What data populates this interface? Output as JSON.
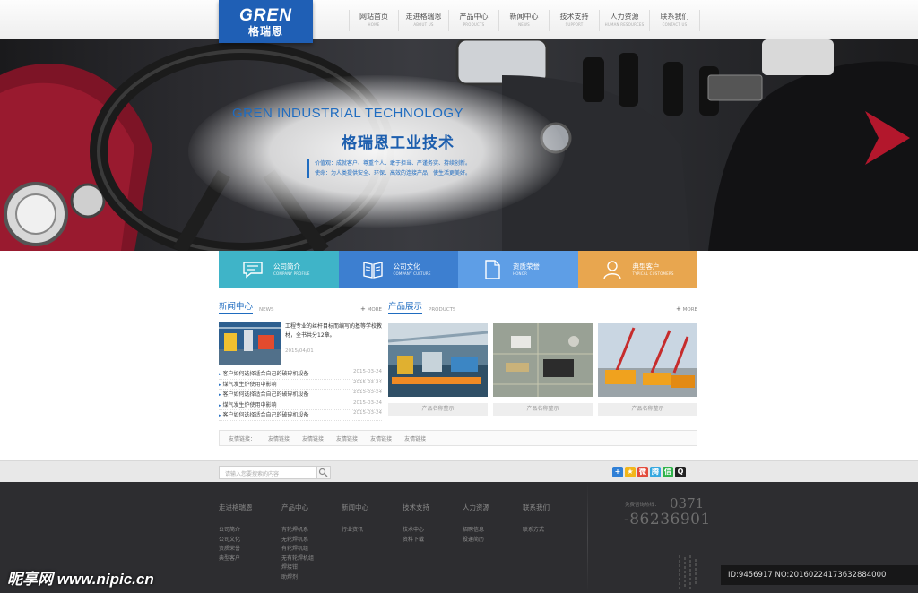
{
  "header": {
    "logo_en": "GREN",
    "logo_cn": "格瑞恩",
    "nav": [
      {
        "cn": "网站首页",
        "en": "HOME"
      },
      {
        "cn": "走进格瑞恩",
        "en": "ABOUT US"
      },
      {
        "cn": "产品中心",
        "en": "PRODUCTS"
      },
      {
        "cn": "新闻中心",
        "en": "NEWS"
      },
      {
        "cn": "技术支持",
        "en": "SUPPORT"
      },
      {
        "cn": "人力资源",
        "en": "HUMAN RESOURCES"
      },
      {
        "cn": "联系我们",
        "en": "CONTACT US"
      }
    ]
  },
  "banner": {
    "title_en": "GREN  INDUSTRIAL TECHNOLOGY",
    "title_cn": "格瑞恩工业技术",
    "line1": "价值观：成就客户、尊重个人、敢于担当、严谨务实、持续创新。",
    "line2": "使命：为人类提供安全、环保、高效的连接产品，使生活更美好。"
  },
  "tiles": [
    {
      "cn": "公司简介",
      "en": "COMPANY PROFILE",
      "color": "#3fb4c8",
      "icon": "chat-bubble-icon"
    },
    {
      "cn": "公司文化",
      "en": "COMPANY CULTURE",
      "color": "#3d7fd0",
      "icon": "open-book-icon"
    },
    {
      "cn": "资质荣誉",
      "en": "HONOR",
      "color": "#5e9ee6",
      "icon": "document-icon"
    },
    {
      "cn": "典型客户",
      "en": "TYPICAL CUSTOMERS",
      "color": "#e8a64f",
      "icon": "user-icon"
    }
  ],
  "news": {
    "title": "新闻中心",
    "title_en": "NEWS",
    "more": "MORE",
    "feature_text": "工程专业的丝杆目标而编写的基等学校教材，全书共分12章。",
    "feature_date": "2015/04/01",
    "items": [
      {
        "title": "客户如何选择适合自己的破碎机设备",
        "date": "2015-03-24"
      },
      {
        "title": "煤气发生炉使用中影响",
        "date": "2015-03-24"
      },
      {
        "title": "客户如何选择适合自己的破碎机设备",
        "date": "2015-03-24"
      },
      {
        "title": "煤气发生炉使用中影响",
        "date": "2015-03-24"
      },
      {
        "title": "客户如何选择适合自己的破碎机设备",
        "date": "2015-03-24"
      }
    ]
  },
  "products": {
    "title": "产品展示",
    "title_en": "PRODUCTS",
    "more": "MORE",
    "items": [
      {
        "caption": "产品名称整示"
      },
      {
        "caption": "产品名称整示"
      },
      {
        "caption": "产品名称整示"
      }
    ]
  },
  "links": {
    "label": "友情链接：",
    "items": [
      "友情链接",
      "友情链接",
      "友情链接",
      "友情链接",
      "友情链接"
    ]
  },
  "search": {
    "placeholder": "请输入您要搜索的内容"
  },
  "footer": {
    "columns": [
      {
        "title": "走进格瑞恩",
        "links": [
          "公司简介",
          "公司文化",
          "资质荣誉",
          "典型客户"
        ]
      },
      {
        "title": "产品中心",
        "links": [
          "有轮焊机系",
          "无轮焊机系",
          "有轮焊机组",
          "无有轮焊机组",
          "焊接钳",
          "助焊剂"
        ]
      },
      {
        "title": "新闻中心",
        "links": [
          "行业资讯"
        ]
      },
      {
        "title": "技术支持",
        "links": [
          "技术中心",
          "资料下载"
        ]
      },
      {
        "title": "人力资源",
        "links": [
          "招聘信息",
          "投递简历"
        ]
      },
      {
        "title": "联系我们",
        "links": [
          "联系方式"
        ]
      }
    ],
    "phone_label": "免费咨询热线：",
    "phone_area": "0371",
    "phone_number": "-86236901"
  },
  "watermark": {
    "left": "昵享网 www.nipic.cn",
    "right": "ID:9456917 NO:20160224173632884000"
  }
}
